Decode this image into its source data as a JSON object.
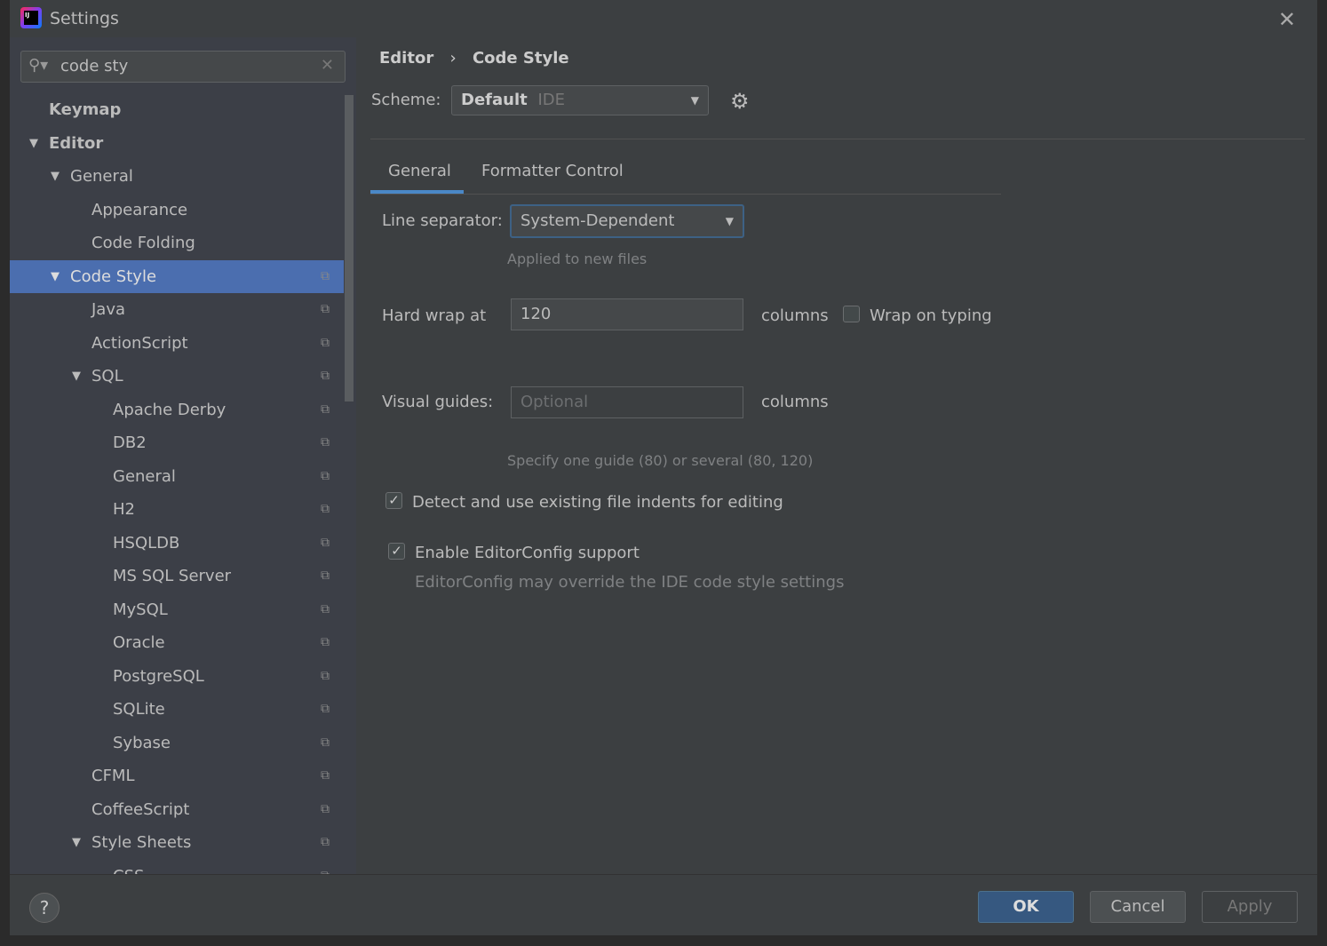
{
  "window": {
    "title": "Settings",
    "close_icon": "close-icon"
  },
  "search": {
    "value": "code sty"
  },
  "tree": [
    {
      "label": "Keymap",
      "level": 0,
      "bold": true
    },
    {
      "label": "Editor",
      "level": 0,
      "bold": true,
      "expanded": true
    },
    {
      "label": "General",
      "level": 1,
      "expanded": true
    },
    {
      "label": "Appearance",
      "level": 2
    },
    {
      "label": "Code Folding",
      "level": 2
    },
    {
      "label": "Code Style",
      "level": 1,
      "expanded": true,
      "selected": true,
      "copy": true
    },
    {
      "label": "Java",
      "level": 2,
      "copy": true
    },
    {
      "label": "ActionScript",
      "level": 2,
      "copy": true
    },
    {
      "label": "SQL",
      "level": 2,
      "expanded": true,
      "copy": true
    },
    {
      "label": "Apache Derby",
      "level": 3,
      "copy": true
    },
    {
      "label": "DB2",
      "level": 3,
      "copy": true
    },
    {
      "label": "General",
      "level": 3,
      "copy": true
    },
    {
      "label": "H2",
      "level": 3,
      "copy": true
    },
    {
      "label": "HSQLDB",
      "level": 3,
      "copy": true
    },
    {
      "label": "MS SQL Server",
      "level": 3,
      "copy": true
    },
    {
      "label": "MySQL",
      "level": 3,
      "copy": true
    },
    {
      "label": "Oracle",
      "level": 3,
      "copy": true
    },
    {
      "label": "PostgreSQL",
      "level": 3,
      "copy": true
    },
    {
      "label": "SQLite",
      "level": 3,
      "copy": true
    },
    {
      "label": "Sybase",
      "level": 3,
      "copy": true
    },
    {
      "label": "CFML",
      "level": 2,
      "copy": true
    },
    {
      "label": "CoffeeScript",
      "level": 2,
      "copy": true
    },
    {
      "label": "Style Sheets",
      "level": 2,
      "expanded": true,
      "copy": true
    },
    {
      "label": "CSS",
      "level": 3,
      "copy": true
    }
  ],
  "breadcrumb": [
    "Editor",
    "Code Style"
  ],
  "scheme": {
    "label": "Scheme:",
    "name": "Default",
    "type": "IDE"
  },
  "tabs": [
    "General",
    "Formatter Control"
  ],
  "general": {
    "line_sep_label": "Line separator:",
    "line_sep_value": "System-Dependent",
    "line_sep_hint": "Applied to new files",
    "hard_wrap_label": "Hard wrap at",
    "hard_wrap_value": "120",
    "columns": "columns",
    "wrap_typing": "Wrap on typing",
    "wrap_typing_checked": false,
    "guides_label": "Visual guides:",
    "guides_placeholder": "Optional",
    "guides_hint": "Specify one guide (80) or several (80, 120)",
    "detect_indent": "Detect and use existing file indents for editing",
    "detect_checked": true,
    "editorconfig": "Enable EditorConfig support",
    "editorconfig_checked": true,
    "editorconfig_hint": "EditorConfig may override the IDE code style settings"
  },
  "footer": {
    "help": "?",
    "ok": "OK",
    "cancel": "Cancel",
    "apply": "Apply"
  },
  "colors": {
    "accent": "#4b6eaf",
    "ok": "#365880"
  }
}
